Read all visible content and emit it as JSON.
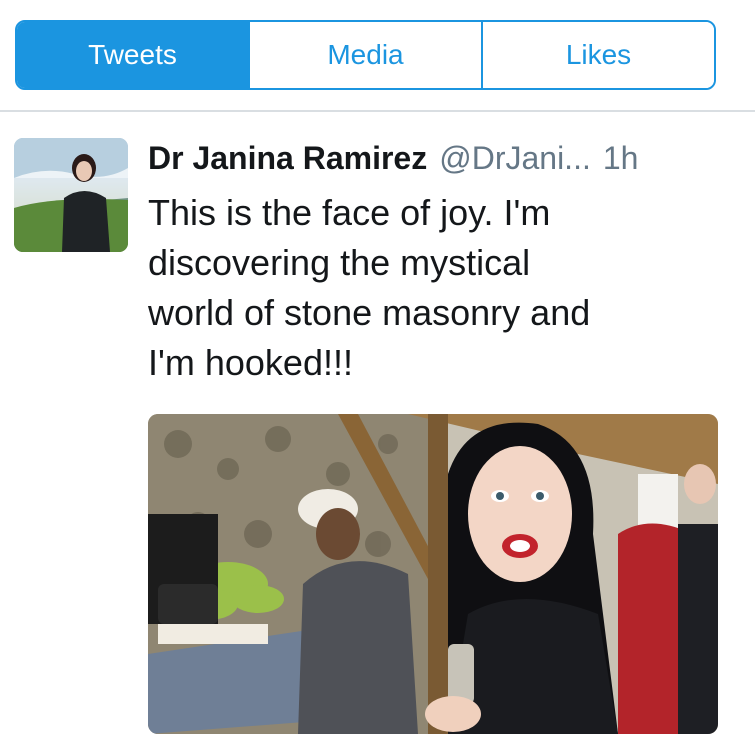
{
  "tabs": [
    {
      "label": "Tweets",
      "active": true
    },
    {
      "label": "Media",
      "active": false
    },
    {
      "label": "Likes",
      "active": false
    }
  ],
  "tweet": {
    "author_name": "Dr Janina Ramirez",
    "handle": "@DrJani...",
    "time": "1h",
    "text": "This is the face of joy. I'm\ndiscovering the mystical\nworld of stone masonry and\nI'm hooked!!!"
  },
  "colors": {
    "accent": "#1b95e0",
    "text": "#14171a",
    "secondary_text": "#657786"
  }
}
